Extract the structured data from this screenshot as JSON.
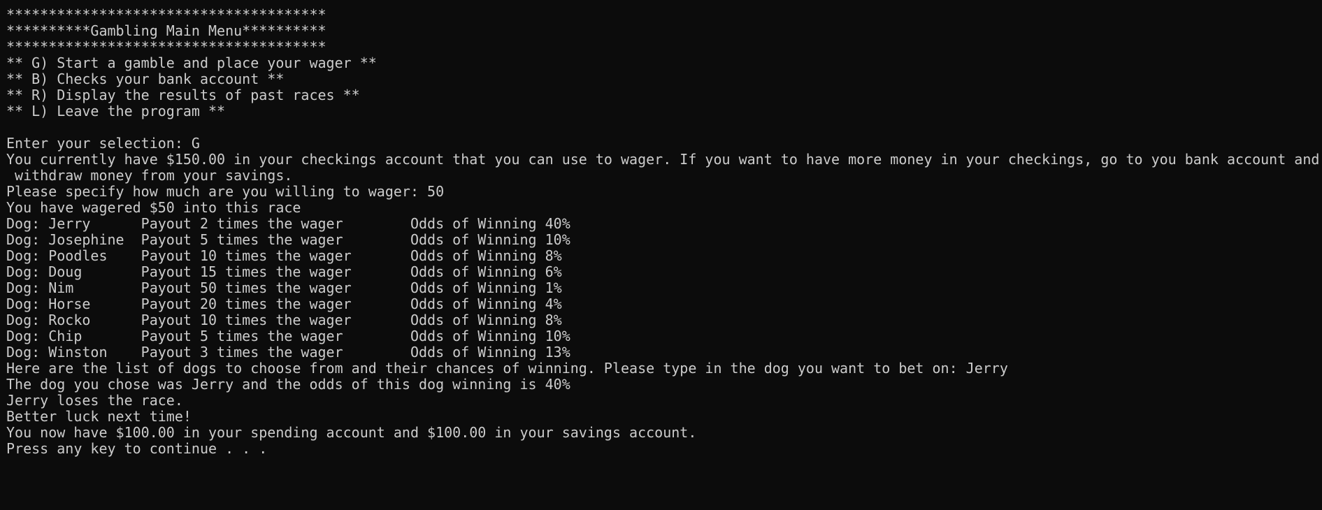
{
  "console": {
    "background": "#0c0c0c",
    "foreground": "#cccccc",
    "lines": [
      "**************************************",
      "**********Gambling Main Menu**********",
      "**************************************",
      "** G) Start a gamble and place your wager **",
      "** B) Checks your bank account **",
      "** R) Display the results of past races **",
      "** L) Leave the program **",
      "",
      "Enter your selection: G",
      "You currently have $150.00 in your checkings account that you can use to wager. If you want to have more money in your checkings, go to you bank account and",
      " withdraw money from your savings.",
      "Please specify how much are you willing to wager: 50",
      "You have wagered $50 into this race",
      "Dog: Jerry      Payout 2 times the wager        Odds of Winning 40%",
      "Dog: Josephine  Payout 5 times the wager        Odds of Winning 10%",
      "Dog: Poodles    Payout 10 times the wager       Odds of Winning 8%",
      "Dog: Doug       Payout 15 times the wager       Odds of Winning 6%",
      "Dog: Nim        Payout 50 times the wager       Odds of Winning 1%",
      "Dog: Horse      Payout 20 times the wager       Odds of Winning 4%",
      "Dog: Rocko      Payout 10 times the wager       Odds of Winning 8%",
      "Dog: Chip       Payout 5 times the wager        Odds of Winning 10%",
      "Dog: Winston    Payout 3 times the wager        Odds of Winning 13%",
      "Here are the list of dogs to choose from and their chances of winning. Please type in the dog you want to bet on: Jerry",
      "The dog you chose was Jerry and the odds of this dog winning is 40%",
      "Jerry loses the race.",
      "Better luck next time!",
      "You now have $100.00 in your spending account and $100.00 in your savings account.",
      "Press any key to continue . . ."
    ]
  }
}
